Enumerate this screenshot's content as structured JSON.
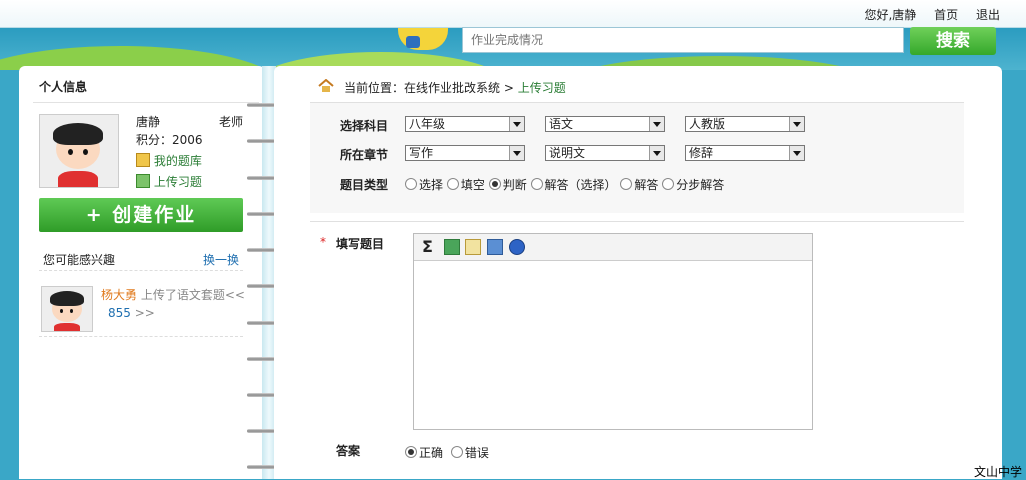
{
  "topbar": {
    "greeting": "您好,唐静",
    "home": "首页",
    "logout": "退出"
  },
  "search": {
    "placeholder": "作业完成情况",
    "button": "搜索"
  },
  "profile": {
    "section_title": "个人信息",
    "name": "唐静",
    "role": "老师",
    "points": "积分：2006",
    "my_bank": "我的题库",
    "upload": "上传习题",
    "create_button": "+ 创建作业"
  },
  "interest": {
    "title": "您可能感兴趣",
    "swap": "换一换",
    "user": "杨大勇",
    "action": "上传了语文套题<<",
    "count": "855",
    "more": ">>"
  },
  "breadcrumb": {
    "prefix": "当前位置：在线作业批改系统 > ",
    "current": "上传习题"
  },
  "filters": {
    "subject_label": "选择科目",
    "chapter_label": "所在章节",
    "type_label": "题目类型",
    "grade": "八年级",
    "subject": "语文",
    "edition": "人教版",
    "chapter1": "写作",
    "chapter2": "说明文",
    "chapter3": "修辞",
    "types": [
      "选择",
      "填空",
      "判断",
      "解答（选择）",
      "解答",
      "分步解答"
    ],
    "selected_type": "判断"
  },
  "question": {
    "required_mark": "*",
    "label": "填写题目"
  },
  "answer": {
    "label": "答案",
    "options": [
      "正确",
      "错误"
    ],
    "selected": "正确"
  },
  "footer": {
    "school": "文山中学"
  },
  "colors": {
    "accent_green": "#35a82b",
    "link_green": "#2a7d35",
    "orange": "#e07b1f",
    "bg_blue": "#3aa7c7"
  }
}
